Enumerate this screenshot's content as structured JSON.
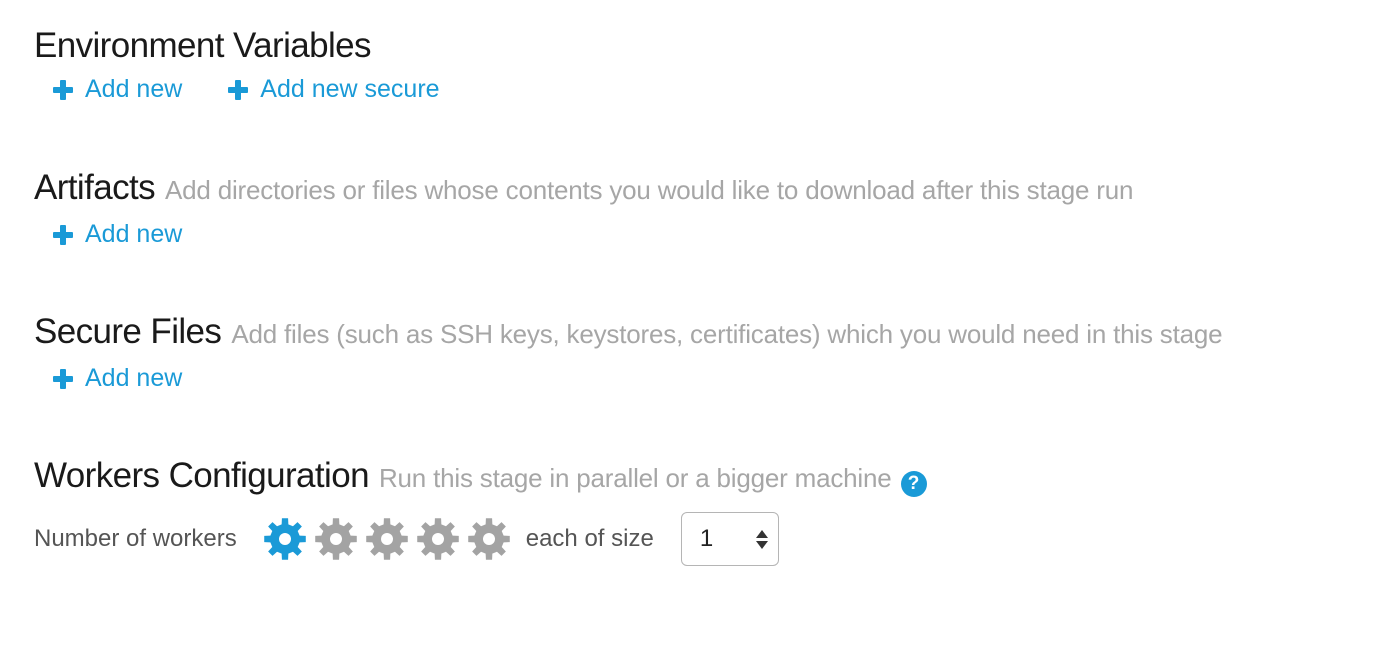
{
  "colors": {
    "accent": "#1a9ad7",
    "gear_inactive": "#a3a3a3",
    "title": "#1a1a1a",
    "description": "#a6a6a6"
  },
  "env_vars": {
    "title": "Environment Variables",
    "add_new_label": "Add new",
    "add_new_secure_label": "Add new secure"
  },
  "artifacts": {
    "title": "Artifacts",
    "description": "Add directories or files whose contents you would like to download after this stage run",
    "add_new_label": "Add new"
  },
  "secure_files": {
    "title": "Secure Files",
    "description": "Add files (such as SSH keys, keystores, certificates) which you would need in this stage",
    "add_new_label": "Add new"
  },
  "workers": {
    "title": "Workers Configuration",
    "description": "Run this stage in parallel or a bigger machine",
    "help_glyph": "?",
    "number_label": "Number of workers",
    "selected_workers": 1,
    "max_workers": 5,
    "size_label": "each of size",
    "size_value": "1"
  }
}
